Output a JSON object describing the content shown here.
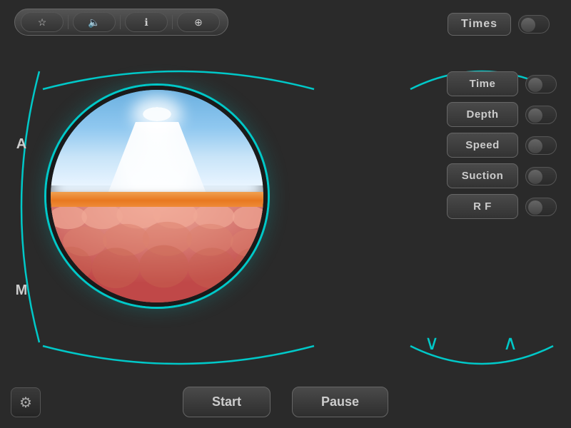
{
  "toolbar": {
    "star_icon": "☆",
    "volume_icon": "🔈",
    "info_icon": "ℹ",
    "add_icon": "⊕"
  },
  "times_section": {
    "label": "Times",
    "toggle_state": false
  },
  "left_labels": {
    "a_label": "A",
    "m_label": "M"
  },
  "right_controls": {
    "toggles": [
      {
        "label": "Time",
        "enabled": false
      },
      {
        "label": "Depth",
        "enabled": false
      },
      {
        "label": "Speed",
        "enabled": false
      },
      {
        "label": "Suction",
        "enabled": false
      },
      {
        "label": "R F",
        "enabled": false
      }
    ]
  },
  "chevrons": {
    "down": "∨",
    "up": "∧"
  },
  "bottom": {
    "settings_icon": "⚙",
    "start_label": "Start",
    "pause_label": "Pause"
  }
}
